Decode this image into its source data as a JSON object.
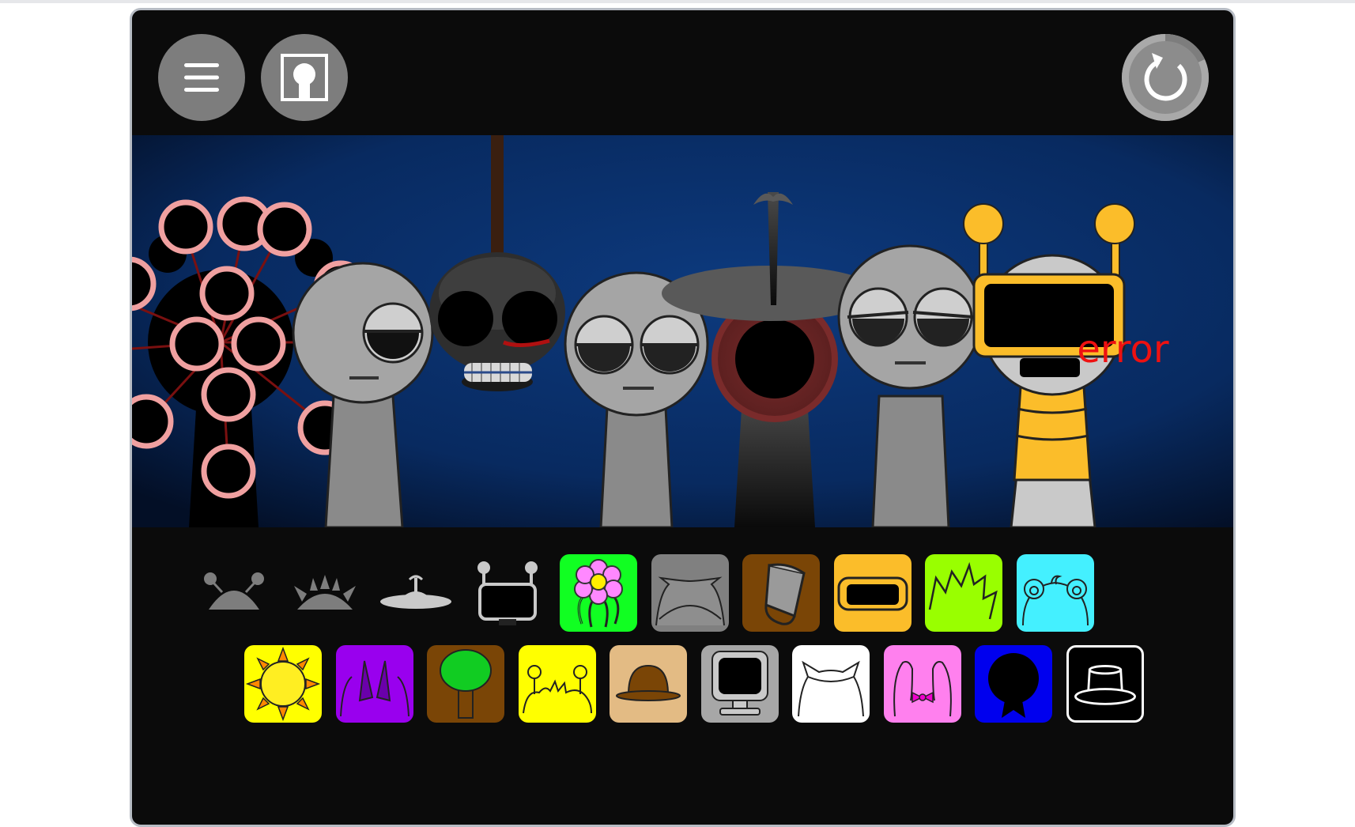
{
  "game": {
    "toolbar": {
      "menu_icon": "hamburger-menu-icon",
      "mode_icon": "head-silhouette-icon",
      "reset_icon": "reset-icon"
    },
    "stage": {
      "characters": [
        {
          "name": "eye-cluster-polo",
          "label": ""
        },
        {
          "name": "hanging-skull-polo",
          "label": ""
        },
        {
          "name": "sleepy-gray-polo",
          "label": ""
        },
        {
          "name": "hat-eye-polo",
          "label": ""
        },
        {
          "name": "tired-gray-polo",
          "label": ""
        },
        {
          "name": "robot-error-polo",
          "label": "error"
        }
      ],
      "screen_text": "error"
    },
    "palette": {
      "row1": [
        {
          "name": "antenna-dome-icon",
          "color": "none",
          "active": false
        },
        {
          "name": "spiky-helmet-icon",
          "color": "none",
          "active": false
        },
        {
          "name": "saucer-hat-icon",
          "color": "none",
          "active": false
        },
        {
          "name": "robot-monitor-icon",
          "color": "none",
          "active": false
        },
        {
          "name": "flower-icon",
          "color": "#11ff22",
          "active": true
        },
        {
          "name": "cat-ears-icon",
          "color": "#808080",
          "active": true
        },
        {
          "name": "bucket-hat-icon",
          "color": "#7a4506",
          "active": true
        },
        {
          "name": "visor-icon",
          "color": "#fbbd2a",
          "active": true
        },
        {
          "name": "spiky-hair-icon",
          "color": "#99ff00",
          "active": true
        },
        {
          "name": "bear-ears-icon",
          "color": "#44f0ff",
          "active": true
        }
      ],
      "row2": [
        {
          "name": "sun-icon",
          "color": "#ffff00",
          "active": true
        },
        {
          "name": "horns-icon",
          "color": "#9900ee",
          "active": true
        },
        {
          "name": "tree-icon",
          "color": "#7a4506",
          "active": true
        },
        {
          "name": "antenna-hair-icon",
          "color": "#ffff00",
          "active": true
        },
        {
          "name": "bowler-hat-icon",
          "color": "#e3bb84",
          "active": true
        },
        {
          "name": "computer-icon",
          "color": "#a7a7a7",
          "active": true
        },
        {
          "name": "white-ears-icon",
          "color": "#ffffff",
          "active": true
        },
        {
          "name": "bunny-ears-icon",
          "color": "#ff80ee",
          "active": true
        },
        {
          "name": "dark-orb-icon",
          "color": "#0000ee",
          "active": true
        },
        {
          "name": "top-hat-icon",
          "color": "#000000",
          "active": true
        }
      ]
    }
  },
  "colors": {
    "frame_bg": "#0b0b0b",
    "button_gray": "#7d7d7d",
    "stage_blue": "#0d3a7e",
    "error_red": "#ee1111",
    "robot_yellow": "#fbbd2a"
  }
}
